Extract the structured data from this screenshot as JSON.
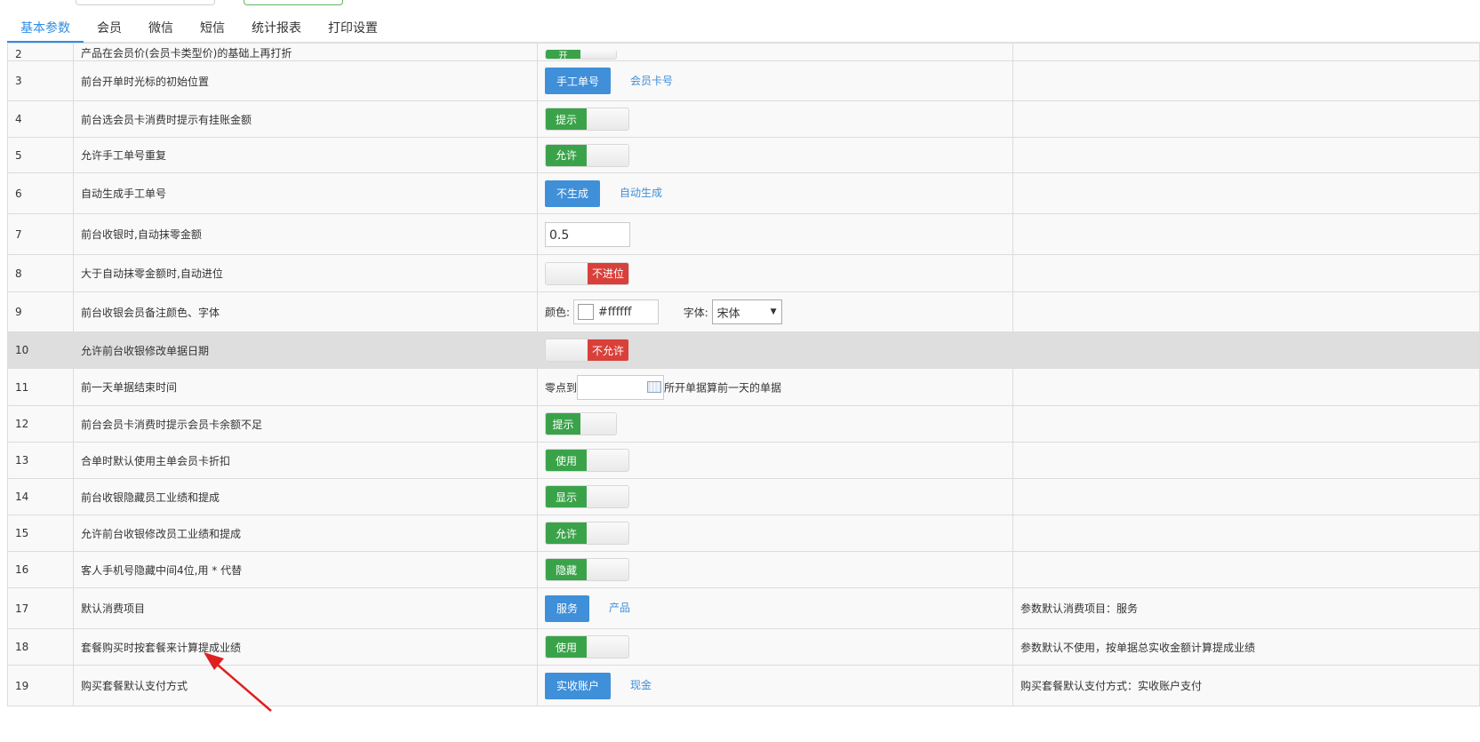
{
  "tabs": [
    "基本参数",
    "会员",
    "微信",
    "短信",
    "统计报表",
    "打印设置"
  ],
  "partial_row": {
    "index": "2",
    "label": "产品在会员价(会员卡类型价)的基础上再打折",
    "switch_on": "开"
  },
  "rows": {
    "r3": {
      "index": "3",
      "label": "前台开单时光标的初始位置",
      "button": "手工单号",
      "option": "会员卡号",
      "note": ""
    },
    "r4": {
      "index": "4",
      "label": "前台选会员卡消费时提示有挂账金额",
      "switch_on": "提示"
    },
    "r5": {
      "index": "5",
      "label": "允许手工单号重复",
      "switch_on": "允许"
    },
    "r6": {
      "index": "6",
      "label": "自动生成手工单号",
      "button": "不生成",
      "option": "自动生成"
    },
    "r7": {
      "index": "7",
      "label": "前台收银时,自动抹零金额",
      "input_value": "0.5"
    },
    "r8": {
      "index": "8",
      "label": "大于自动抹零金额时,自动进位",
      "switch_off": "不进位"
    },
    "r9": {
      "index": "9",
      "label": "前台收银会员备注颜色、字体",
      "color_label": "颜色:",
      "color_value": "#ffffff",
      "font_label": "字体:",
      "font_value": "宋体"
    },
    "r10": {
      "index": "10",
      "label": "允许前台收银修改单据日期",
      "switch_off": "不允许"
    },
    "r11": {
      "index": "11",
      "label": "前一天单据结束时间",
      "prefix": "零点到",
      "date_value": "",
      "suffix": "所开单据算前一天的单据"
    },
    "r12": {
      "index": "12",
      "label": "前台会员卡消费时提示会员卡余额不足",
      "switch_on": "提示"
    },
    "r13": {
      "index": "13",
      "label": "合单时默认使用主单会员卡折扣",
      "switch_on": "使用"
    },
    "r14": {
      "index": "14",
      "label": "前台收银隐藏员工业绩和提成",
      "switch_on": "显示"
    },
    "r15": {
      "index": "15",
      "label": "允许前台收银修改员工业绩和提成",
      "switch_on": "允许"
    },
    "r16": {
      "index": "16",
      "label": "客人手机号隐藏中间4位,用 * 代替",
      "switch_on": "隐藏"
    },
    "r17": {
      "index": "17",
      "label": "默认消费项目",
      "button": "服务",
      "option": "产品",
      "note": "参数默认消费项目：服务"
    },
    "r18": {
      "index": "18",
      "label": "套餐购买时按套餐来计算提成业绩",
      "switch_on": "使用",
      "note": "参数默认不使用，按单据总实收金额计算提成业绩"
    },
    "r19": {
      "index": "19",
      "label": "购买套餐默认支付方式",
      "button": "实收账户",
      "option": "现金",
      "note": "购买套餐默认支付方式：实收账户支付"
    }
  },
  "colors": {
    "accent": "#3f8fd9",
    "switch_on": "#3aa34a",
    "switch_off": "#d9403a",
    "arrow": "#e02020"
  },
  "icons": {
    "select_arrow": "caret-down-icon",
    "date_picker": "calendar-icon"
  }
}
